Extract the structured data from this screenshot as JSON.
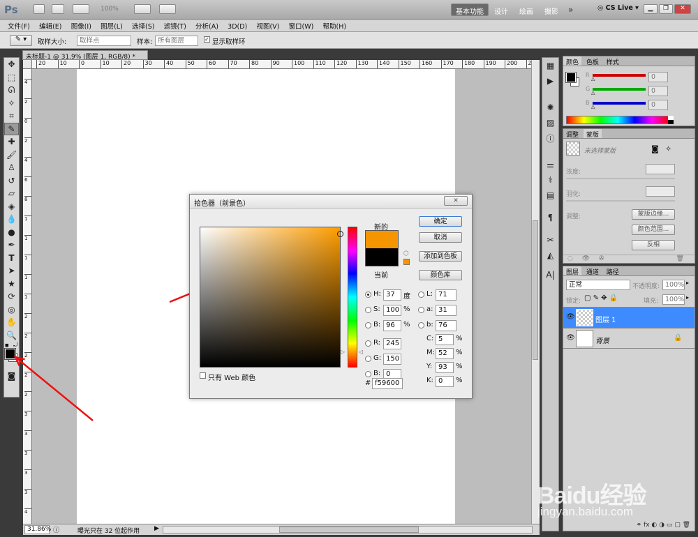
{
  "appbar": {
    "logo": "Ps",
    "zoom": "100%",
    "workspaces": [
      "基本功能",
      "设计",
      "绘画",
      "摄影"
    ],
    "more": "»",
    "cslive": "CS Live"
  },
  "menu": [
    "文件(F)",
    "编辑(E)",
    "图像(I)",
    "图层(L)",
    "选择(S)",
    "滤镜(T)",
    "分析(A)",
    "3D(D)",
    "视图(V)",
    "窗口(W)",
    "帮助(H)"
  ],
  "options": {
    "sample_size_label": "取样大小:",
    "sample_size_value": "取样点",
    "sample_label": "样本:",
    "sample_value": "所有图层",
    "ring_label": "显示取样环"
  },
  "document": {
    "tab_title": "未标题-1 @ 31.9% (图层 1, RGB/8) *",
    "ruler_h": [
      "20",
      "10",
      "0",
      "10",
      "20",
      "30",
      "40",
      "50",
      "60",
      "70",
      "80",
      "90",
      "100",
      "110",
      "120",
      "130",
      "140",
      "150",
      "160",
      "170",
      "180",
      "190",
      "200",
      "210"
    ],
    "ruler_v": [
      "4",
      "2",
      "0",
      "2",
      "4",
      "6",
      "8",
      "1",
      "1",
      "1",
      "1",
      "1",
      "2",
      "2",
      "2",
      "2",
      "2",
      "3",
      "3",
      "3",
      "3",
      "3",
      "4"
    ]
  },
  "status": {
    "zoom": "31.86%",
    "message": "曝光只在 32 位起作用"
  },
  "color_panel": {
    "tabs": [
      "颜色",
      "色板",
      "样式"
    ],
    "channels": [
      {
        "label": "R",
        "value": "0",
        "color": "#cc0000"
      },
      {
        "label": "G",
        "value": "0",
        "color": "#00aa00"
      },
      {
        "label": "B",
        "value": "0",
        "color": "#0000cc"
      }
    ]
  },
  "adjust_panel": {
    "tabs": [
      "调整",
      "蒙版"
    ],
    "mask_text": "未选择蒙版",
    "density": "浓度:",
    "feather": "羽化:",
    "refine": "调整:",
    "buttons": [
      "蒙版边缘...",
      "颜色范围...",
      "反相"
    ]
  },
  "layers_panel": {
    "tabs": [
      "图层",
      "通道",
      "路径"
    ],
    "blend": "正常",
    "opacity_label": "不透明度:",
    "opacity": "100%",
    "lock_label": "锁定:",
    "fill_label": "填充:",
    "fill": "100%",
    "layers": [
      {
        "name": "图层 1",
        "selected": true
      },
      {
        "name": "背景",
        "selected": false
      }
    ]
  },
  "picker": {
    "title": "拾色器（前景色）",
    "close": "✕",
    "new_label": "新的",
    "current_label": "当前",
    "new_color": "#f59600",
    "current_color": "#000000",
    "hue_color": "#ff9d00",
    "buttons": {
      "ok": "确定",
      "cancel": "取消",
      "add": "添加到色板",
      "library": "颜色库"
    },
    "web_only": "只有 Web 颜色",
    "hsb": [
      {
        "label": "H:",
        "value": "37",
        "unit": "度"
      },
      {
        "label": "S:",
        "value": "100",
        "unit": "%"
      },
      {
        "label": "B:",
        "value": "96",
        "unit": "%"
      }
    ],
    "rgb": [
      {
        "label": "R:",
        "value": "245"
      },
      {
        "label": "G:",
        "value": "150"
      },
      {
        "label": "B:",
        "value": "0"
      }
    ],
    "lab": [
      {
        "label": "L:",
        "value": "71"
      },
      {
        "label": "a:",
        "value": "31"
      },
      {
        "label": "b:",
        "value": "76"
      }
    ],
    "cmyk": [
      {
        "label": "C:",
        "value": "5",
        "unit": "%"
      },
      {
        "label": "M:",
        "value": "52",
        "unit": "%"
      },
      {
        "label": "Y:",
        "value": "93",
        "unit": "%"
      },
      {
        "label": "K:",
        "value": "0",
        "unit": "%"
      }
    ],
    "hash": "#",
    "hex": "f59600"
  },
  "watermark": {
    "text": "Baidu经验",
    "url": "jingyan.baidu.com"
  },
  "annotation_color": "#ee1111"
}
